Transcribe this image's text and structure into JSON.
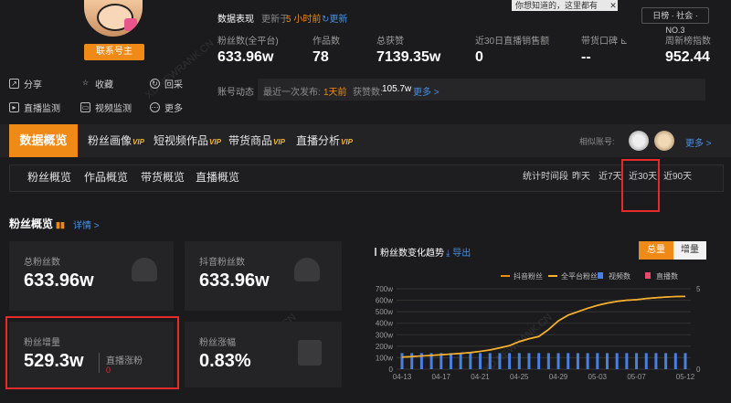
{
  "profile": {
    "contact_button": "联系号主",
    "actions": [
      {
        "label": "分享",
        "icon": "share-icon"
      },
      {
        "label": "收藏",
        "icon": "star-icon"
      },
      {
        "label": "回采",
        "icon": "refresh-icon"
      },
      {
        "label": "直播监测",
        "icon": "live-icon"
      },
      {
        "label": "视频监测",
        "icon": "video-icon"
      },
      {
        "label": "更多",
        "icon": "more-icon"
      }
    ]
  },
  "header": {
    "data_label": "数据表现",
    "update_prefix": "更新于",
    "update_time": "5 小时前",
    "update_link": "更新",
    "tooltip": "你想知道的，这里都有",
    "rank_badge": "日榜 · 社会 · NO.3"
  },
  "stats": [
    {
      "label": "粉丝数(全平台)",
      "value": "633.96w"
    },
    {
      "label": "作品数",
      "value": "78"
    },
    {
      "label": "总获赞",
      "value": "7139.35w"
    },
    {
      "label": "近30日直播销售额",
      "value": "0"
    },
    {
      "label": "带货口碑",
      "value": "--"
    },
    {
      "label": "周新榜指数",
      "value": "952.44"
    }
  ],
  "dynamics": {
    "label": "账号动态",
    "last_publish_label": "最近一次发布:",
    "last_publish": "1天前",
    "likes_label": "获赞数:",
    "likes": "105.7w",
    "more": "更多 >"
  },
  "tabs": {
    "active": "数据概览",
    "items": [
      "粉丝画像",
      "短视频作品",
      "带货商品",
      "直播分析"
    ],
    "vip": "VIP",
    "similar_label": "相似账号:",
    "more": "更多 >"
  },
  "subtabs": {
    "items": [
      "粉丝概览",
      "作品概览",
      "带货概览",
      "直播概览"
    ],
    "range_label": "统计时间段",
    "ranges": [
      "昨天",
      "近7天",
      "近30天",
      "近90天"
    ],
    "selected_range": "近30天"
  },
  "fans_section": {
    "title": "粉丝概览",
    "details": "详情 >",
    "cards": {
      "total_label": "总粉丝数",
      "total_value": "633.96w",
      "douyin_label": "抖音粉丝数",
      "douyin_value": "633.96w",
      "increase_label": "粉丝增量",
      "increase_value": "529.3w",
      "live_label": "直播涨粉",
      "live_value": "0",
      "rate_label": "粉丝涨幅",
      "rate_value": "0.83%"
    }
  },
  "chart_panel": {
    "title": "粉丝数变化趋势",
    "export": "导出",
    "toggle_total": "总量",
    "toggle_increase": "增量"
  },
  "watermark": "XD.NEWRANK.CN",
  "colors": {
    "accent": "#f08a17",
    "highlight": "#e62b2b",
    "link": "#4a90e2",
    "bar": "#4a7fe0"
  },
  "chart_data": {
    "type": "line",
    "x": [
      "04-13",
      "04-14",
      "04-15",
      "04-16",
      "04-17",
      "04-18",
      "04-19",
      "04-20",
      "04-21",
      "04-22",
      "04-23",
      "04-24",
      "04-25",
      "04-26",
      "04-27",
      "04-28",
      "04-29",
      "04-30",
      "05-01",
      "05-02",
      "05-03",
      "05-04",
      "05-05",
      "05-06",
      "05-07",
      "05-08",
      "05-09",
      "05-10",
      "05-11",
      "05-12"
    ],
    "xticks": [
      "04-13",
      "04-17",
      "04-21",
      "04-25",
      "04-29",
      "05-03",
      "05-07",
      "05-12"
    ],
    "series": [
      {
        "name": "抖音粉丝",
        "axis": "left",
        "color": "#f08a17",
        "values": [
          105,
          110,
          115,
          120,
          126,
          131,
          138,
          145,
          155,
          168,
          185,
          205,
          240,
          265,
          285,
          345,
          420,
          470,
          500,
          530,
          555,
          575,
          590,
          600,
          605,
          615,
          622,
          628,
          632,
          634
        ]
      },
      {
        "name": "全平台粉丝",
        "axis": "left",
        "color": "#f5b130",
        "values": [
          105,
          110,
          115,
          120,
          126,
          131,
          138,
          145,
          155,
          168,
          185,
          205,
          240,
          265,
          285,
          345,
          420,
          470,
          500,
          530,
          555,
          575,
          590,
          600,
          605,
          615,
          622,
          628,
          632,
          634
        ]
      },
      {
        "name": "视频数",
        "axis": "right",
        "type": "bar",
        "color": "#4a7fe0",
        "values": [
          1,
          1,
          1,
          1,
          1,
          1,
          1,
          1,
          1,
          1,
          1,
          1,
          1,
          1,
          1,
          1,
          1,
          1,
          1,
          1,
          1,
          1,
          1,
          1,
          1,
          1,
          1,
          1,
          1,
          1
        ]
      },
      {
        "name": "直播数",
        "axis": "right",
        "type": "bar",
        "color": "#e84a6a",
        "values": [
          0,
          0,
          0,
          0,
          0,
          0,
          0,
          0,
          0,
          0,
          0,
          0,
          0,
          0,
          0,
          0,
          0,
          0,
          0,
          0,
          0,
          0,
          0,
          0,
          0,
          0,
          0,
          0,
          0,
          0
        ]
      }
    ],
    "ylim": [
      0,
      700
    ],
    "yticks": [
      "0",
      "100w",
      "200w",
      "300w",
      "400w",
      "500w",
      "600w",
      "700w"
    ],
    "y2lim": [
      0,
      5
    ],
    "y2ticks": [
      "0",
      "5"
    ],
    "legend_position": "top-right",
    "grid": true
  }
}
